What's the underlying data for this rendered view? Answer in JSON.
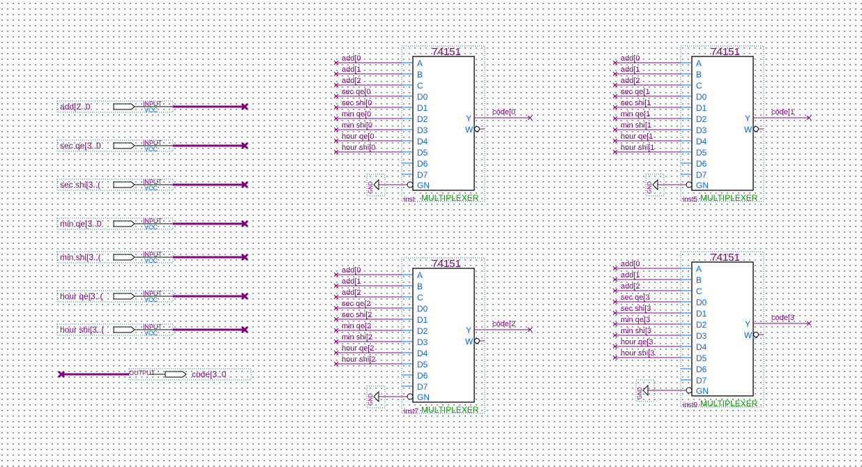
{
  "colors": {
    "wire": "#800080",
    "pin": "#0060ff",
    "dotted_box": "#008080",
    "block_type": "#800080",
    "instance_type": "#00a000",
    "body": "#000000"
  },
  "inputs": [
    {
      "name": "add[2..0",
      "type": "INPUT",
      "default": "VCC"
    },
    {
      "name": "sec  qe[3..0",
      "type": "INPUT",
      "default": "VCC"
    },
    {
      "name": "sec  shi[3..(",
      "type": "INPUT",
      "default": "VCC"
    },
    {
      "name": "min  qe[3..0",
      "type": "INPUT",
      "default": "VCC"
    },
    {
      "name": "min  shi[3..(",
      "type": "INPUT",
      "default": "VCC"
    },
    {
      "name": "hour  qe[3..(",
      "type": "INPUT",
      "default": "VCC"
    },
    {
      "name": "hour  shi[3..(",
      "type": "INPUT",
      "default": "VCC"
    }
  ],
  "output": {
    "name": "code[3..0",
    "type": "OUTPUT"
  },
  "blocks": [
    {
      "title": "74151",
      "instance": "inst",
      "kind": "MULTIPLEXER",
      "gnd": "GND",
      "out_net": "code[0",
      "in_nets": [
        "add[0",
        "add[1",
        "add[2",
        "sec  qe[0",
        "sec  shi[0",
        "min  qe[0",
        "min  shi[0",
        "hour  qe[0",
        "hour  shi[0"
      ]
    },
    {
      "title": "74151",
      "instance": "inst5",
      "kind": "MULTIPLEXER",
      "gnd": "GND",
      "out_net": "code[1",
      "in_nets": [
        "add[0",
        "add[1",
        "add[2",
        "sec  qe[1",
        "sec  shi[1",
        "min  qe[1",
        "min  shi[1",
        "hour  qe[1",
        "hour  shi[1"
      ]
    },
    {
      "title": "74151",
      "instance": "inst7",
      "kind": "MULTIPLEXER",
      "gnd": "GND",
      "out_net": "code[2",
      "in_nets": [
        "add[0",
        "add[1",
        "add[2",
        "sec  qe[2",
        "sec  shi[2",
        "min  qe[2",
        "min  shi[2",
        "hour  qe[2",
        "hour  shi[2"
      ]
    },
    {
      "title": "74151",
      "instance": "inst9",
      "kind": "MULTIPLEXER",
      "gnd": "GND",
      "out_net": "code[3",
      "in_nets": [
        "add[0",
        "add[1",
        "add[2",
        "sec  qe[3",
        "sec  shi[3",
        "min  qe[3",
        "min  shi[3",
        "hour  qe[3",
        "hour  shi[3"
      ]
    }
  ],
  "pins": {
    "inputs": [
      "A",
      "B",
      "C",
      "D0",
      "D1",
      "D2",
      "D3",
      "D4",
      "D5",
      "D6",
      "D7",
      "GN"
    ],
    "outputs": [
      "Y",
      "WN"
    ]
  }
}
